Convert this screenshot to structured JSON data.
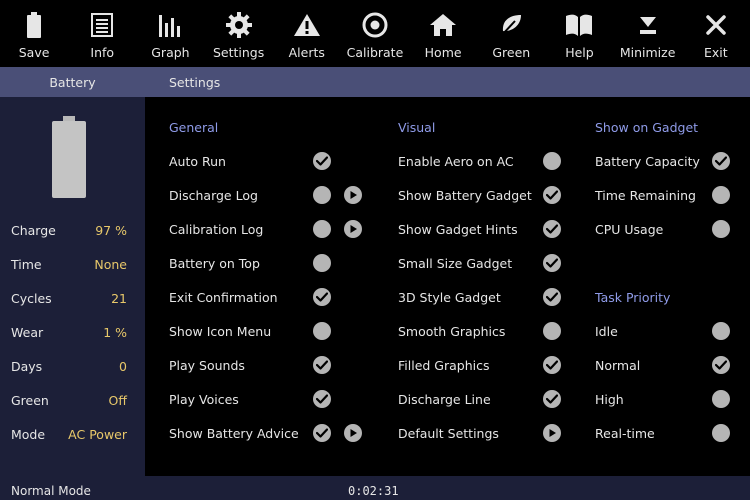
{
  "toolbar": {
    "buttons": [
      {
        "label": "Save",
        "icon": "battery-icon"
      },
      {
        "label": "Info",
        "icon": "document-icon"
      },
      {
        "label": "Graph",
        "icon": "bar-chart-icon"
      },
      {
        "label": "Settings",
        "icon": "gear-icon"
      },
      {
        "label": "Alerts",
        "icon": "warning-icon"
      },
      {
        "label": "Calibrate",
        "icon": "target-icon"
      },
      {
        "label": "Home",
        "icon": "home-icon"
      },
      {
        "label": "Green",
        "icon": "leaf-icon"
      },
      {
        "label": "Help",
        "icon": "book-icon"
      },
      {
        "label": "Minimize",
        "icon": "minimize-icon"
      },
      {
        "label": "Exit",
        "icon": "close-icon"
      }
    ]
  },
  "header": {
    "left": "Battery",
    "right": "Settings"
  },
  "battery_panel": {
    "stats": [
      {
        "label": "Charge",
        "value": "97 %"
      },
      {
        "label": "Time",
        "value": "None"
      },
      {
        "label": "Cycles",
        "value": "21"
      },
      {
        "label": "Wear",
        "value": "1 %"
      },
      {
        "label": "Days",
        "value": "0"
      },
      {
        "label": "Green",
        "value": "Off"
      },
      {
        "label": "Mode",
        "value": "AC Power"
      }
    ]
  },
  "settings": {
    "general": {
      "title": "General",
      "items": [
        {
          "label": "Auto Run",
          "checked": true,
          "play": false
        },
        {
          "label": "Discharge Log",
          "checked": false,
          "play": true
        },
        {
          "label": "Calibration Log",
          "checked": false,
          "play": true
        },
        {
          "label": "Battery on Top",
          "checked": false,
          "play": false
        },
        {
          "label": "Exit Confirmation",
          "checked": true,
          "play": false
        },
        {
          "label": "Show Icon Menu",
          "checked": false,
          "play": false
        },
        {
          "label": "Play Sounds",
          "checked": true,
          "play": false
        },
        {
          "label": "Play Voices",
          "checked": true,
          "play": false
        },
        {
          "label": "Show Battery Advice",
          "checked": true,
          "play": true
        }
      ]
    },
    "visual": {
      "title": "Visual",
      "items": [
        {
          "label": "Enable Aero on AC",
          "checked": false
        },
        {
          "label": "Show Battery Gadget",
          "checked": true
        },
        {
          "label": "Show Gadget Hints",
          "checked": true
        },
        {
          "label": "Small Size Gadget",
          "checked": true
        },
        {
          "label": "3D Style Gadget",
          "checked": true
        },
        {
          "label": "Smooth Graphics",
          "checked": false
        },
        {
          "label": "Filled Graphics",
          "checked": true
        },
        {
          "label": "Discharge Line",
          "checked": true
        },
        {
          "label": "Default Settings",
          "checked": false,
          "play": true
        }
      ]
    },
    "gadget": {
      "title": "Show on Gadget",
      "items": [
        {
          "label": "Battery Capacity",
          "checked": true
        },
        {
          "label": "Time Remaining",
          "checked": false
        },
        {
          "label": "CPU Usage",
          "checked": false
        }
      ]
    },
    "priority": {
      "title": "Task Priority",
      "items": [
        {
          "label": "Idle",
          "checked": false
        },
        {
          "label": "Normal",
          "checked": true
        },
        {
          "label": "High",
          "checked": false
        },
        {
          "label": "Real-time",
          "checked": false
        }
      ]
    }
  },
  "status": {
    "mode": "Normal Mode",
    "time": "0:02:31"
  },
  "colors": {
    "header_band": "#4a4f77",
    "panel_bg": "#1c1f38",
    "section_title": "#8f9be8",
    "stat_value": "#e8c86a",
    "toggle": "#b5b5b5"
  }
}
